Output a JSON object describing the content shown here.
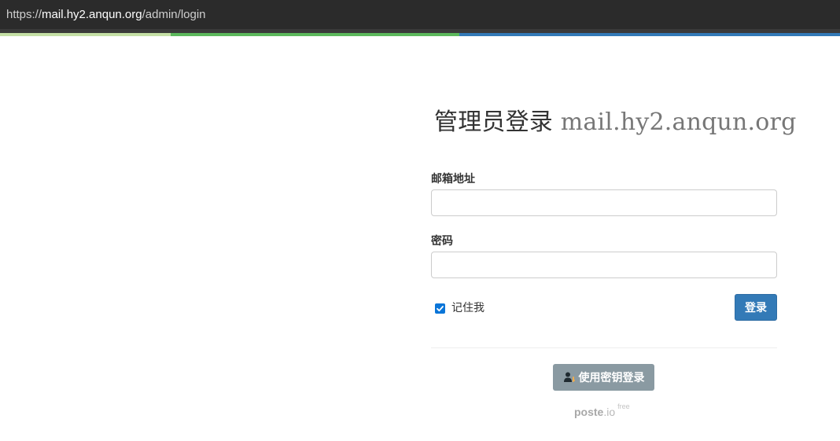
{
  "browser": {
    "url_scheme": "https://",
    "url_host": "mail.hy2.anqun.org",
    "url_path": "/admin/login"
  },
  "login": {
    "title_prefix": "管理员登录",
    "title_host": "mail.hy2.anqun.org",
    "email_label": "邮箱地址",
    "email_value": "",
    "password_label": "密码",
    "password_value": "",
    "remember_label": "记住我",
    "remember_checked": true,
    "submit_label": "登录",
    "key_login_label": "使用密钥登录"
  },
  "footer": {
    "brand_name": "poste",
    "brand_tld": ".io",
    "edition": "free"
  },
  "colors": {
    "stripe_light_green": "#c5e0a5",
    "stripe_green": "#5cb85c",
    "stripe_blue": "#337ab7",
    "primary_button": "#337ab7",
    "secondary_button": "#8a9aa2",
    "checkbox": "#0a75d8"
  },
  "icons": {
    "key_login_icon": "user-key-icon",
    "checkbox_icon": "checkmark-icon"
  }
}
